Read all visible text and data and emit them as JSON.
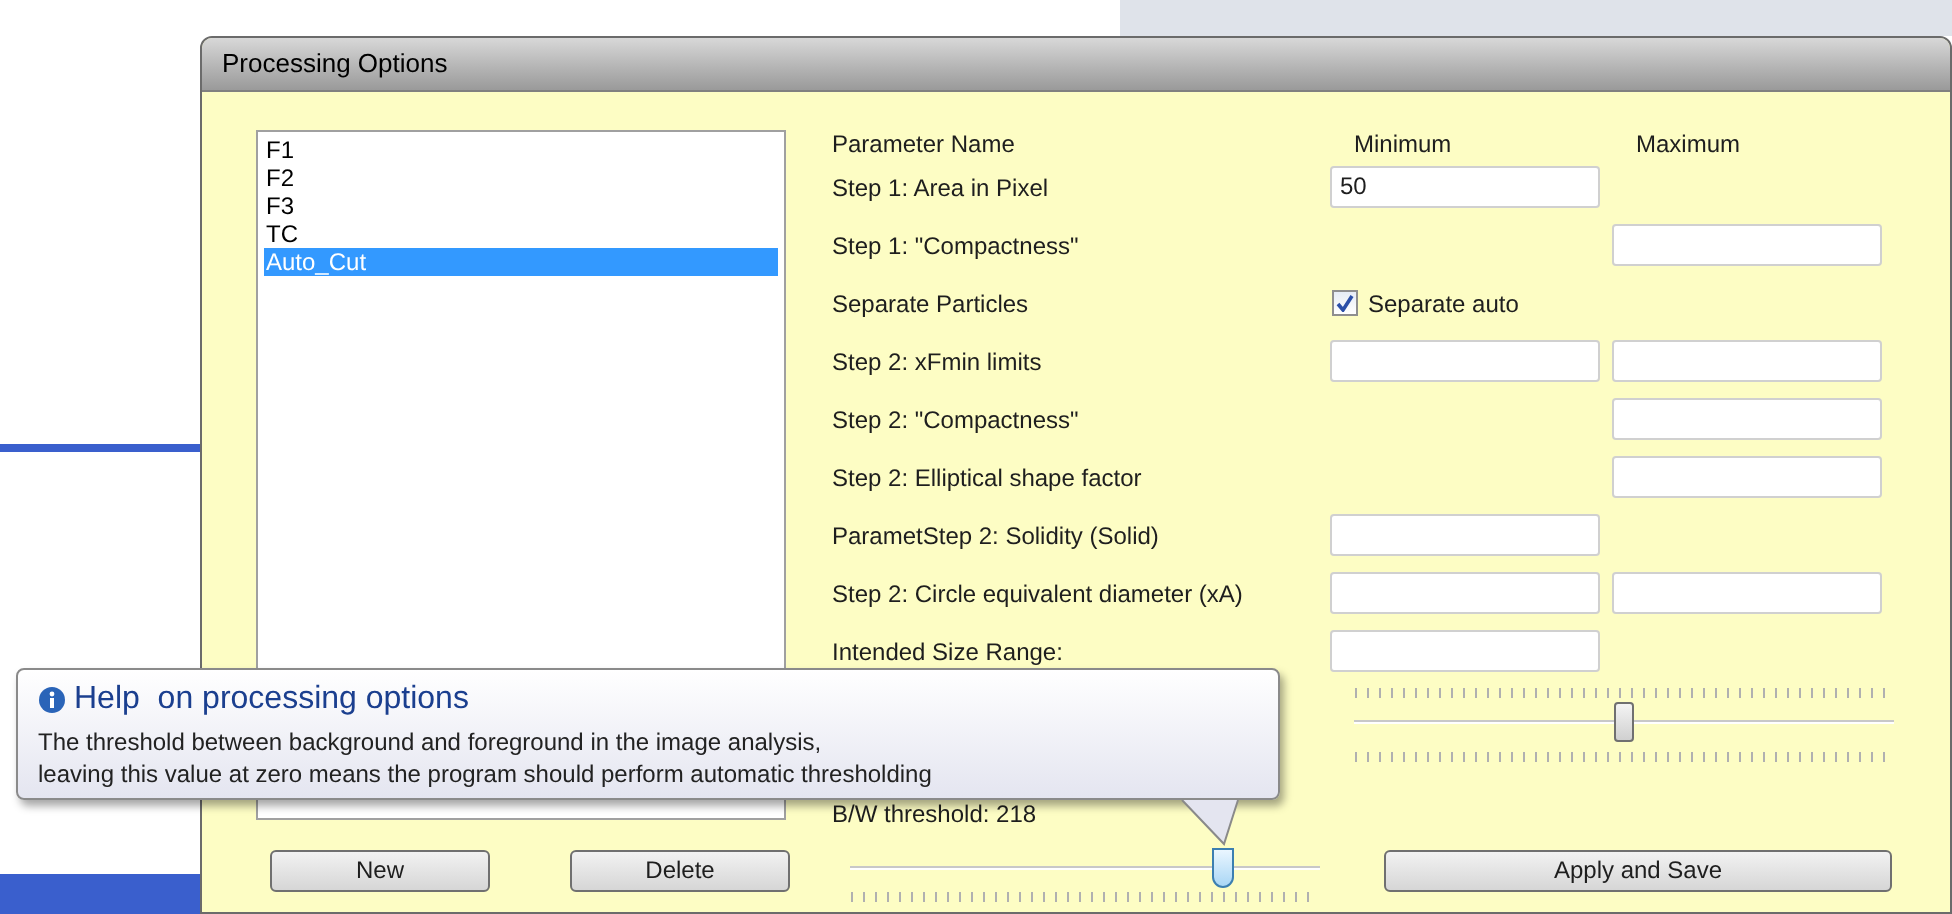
{
  "window": {
    "title": "Processing Options"
  },
  "list": {
    "items": [
      {
        "label": "F1",
        "selected": false
      },
      {
        "label": "F2",
        "selected": false
      },
      {
        "label": "F3",
        "selected": false
      },
      {
        "label": "TC",
        "selected": false
      },
      {
        "label": "Auto_Cut",
        "selected": true
      }
    ]
  },
  "parameters": {
    "columns": [
      "Parameter Name",
      "Minimum",
      "Maximum"
    ],
    "rows": [
      {
        "label": "Step 1: Area in Pixel",
        "kind": "min",
        "minimum": "50"
      },
      {
        "label": "Step 1: \"Compactness\"",
        "kind": "max"
      },
      {
        "label": "Separate Particles",
        "kind": "checkbox",
        "checkbox": {
          "label": "Separate auto",
          "checked": true
        }
      },
      {
        "label": "Step 2: xFmin limits",
        "kind": "range"
      },
      {
        "label": "Step 2: \"Compactness\"",
        "kind": "max"
      },
      {
        "label": "Step 2: Elliptical shape factor",
        "kind": "max"
      },
      {
        "label": "ParametStep 2: Solidity (Solid)",
        "kind": "min"
      },
      {
        "label": "Step 2: Circle equivalent diameter (xA)",
        "kind": "range"
      },
      {
        "label": "Intended Size Range:",
        "kind": "min"
      }
    ]
  },
  "size_slider": {
    "level": 0.5
  },
  "threshold": {
    "label": "B/W threshold: 218",
    "level": 0.81
  },
  "buttons": [
    "New",
    "Delete",
    "Apply and Save"
  ],
  "tooltip": {
    "title": "Help  on processing options",
    "lines": [
      "The threshold between background and foreground in the image analysis,",
      "leaving this value at zero means the program should perform automatic thresholding"
    ]
  }
}
